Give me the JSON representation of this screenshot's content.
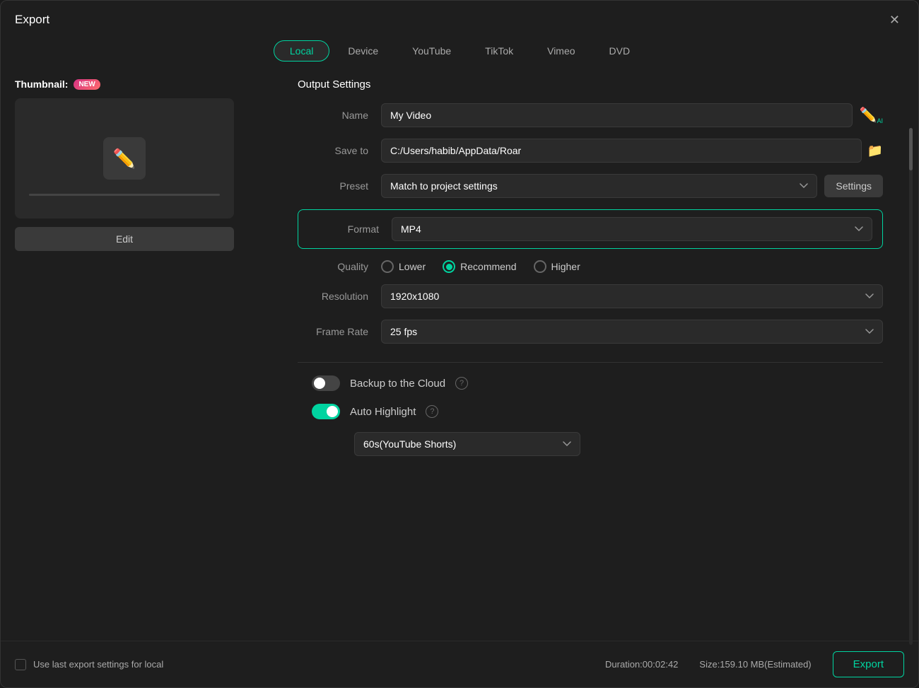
{
  "dialog": {
    "title": "Export",
    "close_label": "✕"
  },
  "tabs": [
    {
      "label": "Local",
      "active": true
    },
    {
      "label": "Device",
      "active": false
    },
    {
      "label": "YouTube",
      "active": false
    },
    {
      "label": "TikTok",
      "active": false
    },
    {
      "label": "Vimeo",
      "active": false
    },
    {
      "label": "DVD",
      "active": false
    }
  ],
  "thumbnail": {
    "label": "Thumbnail:",
    "new_badge": "NEW",
    "edit_button": "Edit"
  },
  "output_settings": {
    "section_title": "Output Settings",
    "name_label": "Name",
    "name_value": "My Video",
    "save_to_label": "Save to",
    "save_to_value": "C:/Users/habib/AppData/Roar",
    "preset_label": "Preset",
    "preset_value": "Match to project settings",
    "settings_button": "Settings",
    "format_label": "Format",
    "format_value": "MP4",
    "quality_label": "Quality",
    "quality_options": [
      {
        "label": "Lower",
        "selected": false
      },
      {
        "label": "Recommend",
        "selected": true
      },
      {
        "label": "Higher",
        "selected": false
      }
    ],
    "resolution_label": "Resolution",
    "resolution_value": "1920x1080",
    "frame_rate_label": "Frame Rate",
    "frame_rate_value": "25 fps"
  },
  "toggles": {
    "backup_cloud": {
      "label": "Backup to the Cloud",
      "state": "off"
    },
    "auto_highlight": {
      "label": "Auto Highlight",
      "state": "on"
    },
    "duration_dropdown": "60s(YouTube Shorts)"
  },
  "bottom": {
    "checkbox_label": "Use last export settings for local",
    "duration": "Duration:00:02:42",
    "size": "Size:159.10 MB(Estimated)",
    "export_button": "Export"
  }
}
